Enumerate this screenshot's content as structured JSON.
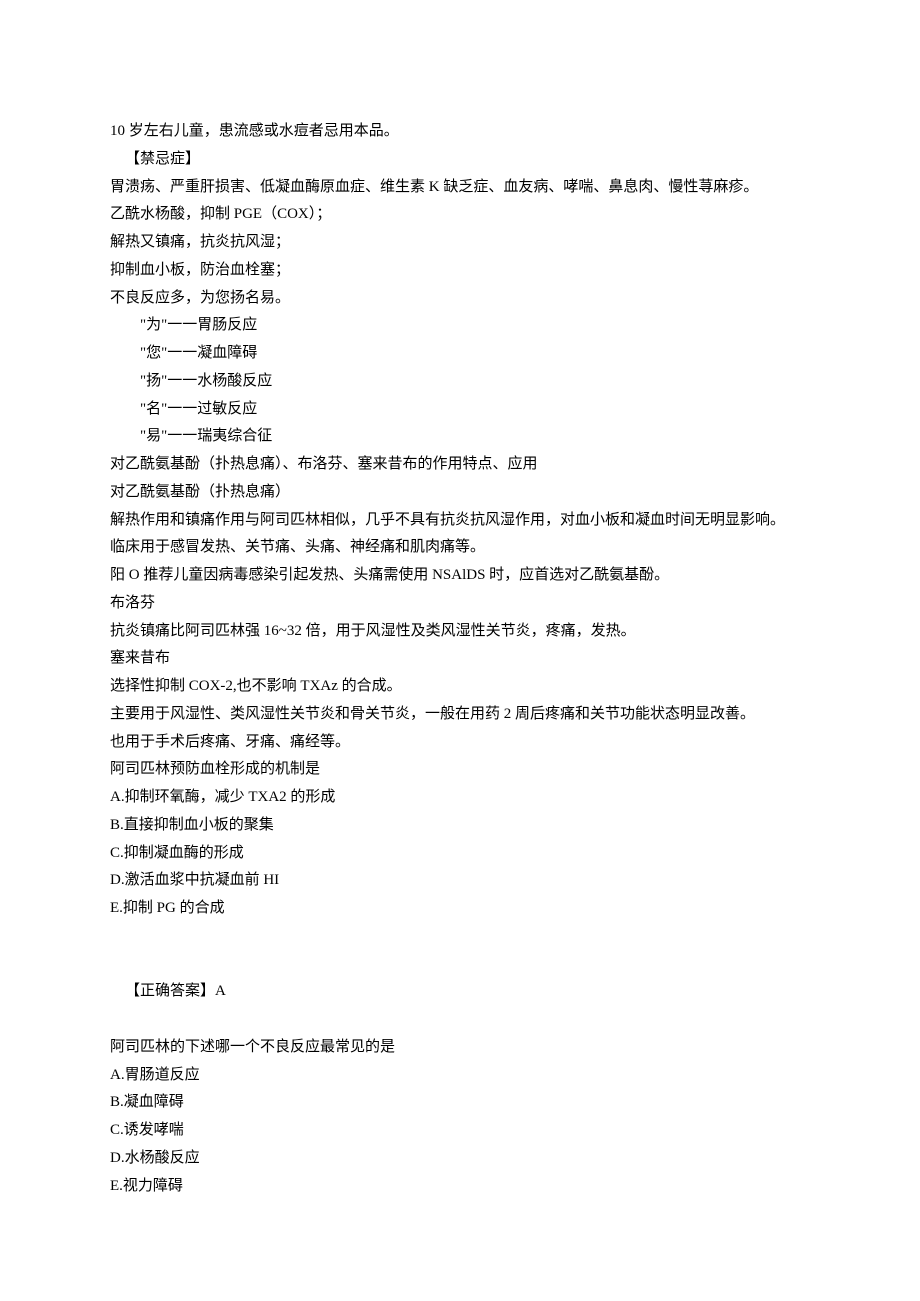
{
  "lines": [
    {
      "text": "10 岁左右儿童，患流感或水痘者忌用本品。",
      "indent": 0
    },
    {
      "text": "【禁忌症】",
      "indent": 1
    },
    {
      "text": "胃溃疡、严重肝损害、低凝血酶原血症、维生素 K 缺乏症、血友病、哮喘、鼻息肉、慢性荨麻疹。",
      "indent": 0
    },
    {
      "text": "乙酰水杨酸，抑制 PGE（COX）；",
      "indent": 0
    },
    {
      "text": "解热又镇痛，抗炎抗风湿；",
      "indent": 0
    },
    {
      "text": "抑制血小板，防治血栓塞；",
      "indent": 0
    },
    {
      "text": "不良反应多，为您扬名易。",
      "indent": 0
    },
    {
      "text": "\"为\"一一胃肠反应",
      "indent": 2
    },
    {
      "text": "\"您\"一一凝血障碍",
      "indent": 2
    },
    {
      "text": "\"扬\"一一水杨酸反应",
      "indent": 2
    },
    {
      "text": "\"名\"一一过敏反应",
      "indent": 2
    },
    {
      "text": "\"易\"一一瑞夷综合征",
      "indent": 2
    },
    {
      "text": "对乙酰氨基酚（扑热息痛）、布洛芬、塞来昔布的作用特点、应用",
      "indent": 0
    },
    {
      "text": "对乙酰氨基酚（扑热息痛）",
      "indent": 0
    },
    {
      "text": "解热作用和镇痛作用与阿司匹林相似，几乎不具有抗炎抗风湿作用，对血小板和凝血时间无明显影响。",
      "indent": 0
    },
    {
      "text": "临床用于感冒发热、关节痛、头痛、神经痛和肌肉痛等。",
      "indent": 0
    },
    {
      "text": "阳 O 推荐儿童因病毒感染引起发热、头痛需使用 NSAlDS 时，应首选对乙酰氨基酚。",
      "indent": 0
    },
    {
      "text": "布洛芬",
      "indent": 0
    },
    {
      "text": "抗炎镇痛比阿司匹林强 16~32 倍，用于风湿性及类风湿性关节炎，疼痛，发热。",
      "indent": 0
    },
    {
      "text": "塞来昔布",
      "indent": 0
    },
    {
      "text": "选择性抑制 COX-2,也不影响 TXAz 的合成。",
      "indent": 0
    },
    {
      "text": "主要用于风湿性、类风湿性关节炎和骨关节炎，一般在用药 2 周后疼痛和关节功能状态明显改善。",
      "indent": 0
    },
    {
      "text": "也用于手术后疼痛、牙痛、痛经等。",
      "indent": 0
    },
    {
      "text": "阿司匹林预防血栓形成的机制是",
      "indent": 0
    },
    {
      "text": "A.抑制环氧酶，减少 TXA2 的形成",
      "indent": 0
    },
    {
      "text": "B.直接抑制血小板的聚集",
      "indent": 0
    },
    {
      "text": "C.抑制凝血酶的形成",
      "indent": 0
    },
    {
      "text": "D.激活血浆中抗凝血前 HI",
      "indent": 0
    },
    {
      "text": "E.抑制 PG 的合成",
      "indent": 0
    },
    {
      "spacer": true
    },
    {
      "spacer": true
    },
    {
      "text": "【正确答案】A",
      "indent": 1
    },
    {
      "spacer": true
    },
    {
      "text": "阿司匹林的下述哪一个不良反应最常见的是",
      "indent": 0
    },
    {
      "text": "A.胃肠道反应",
      "indent": 0
    },
    {
      "text": "B.凝血障碍",
      "indent": 0
    },
    {
      "text": "C.诱发哮喘",
      "indent": 0
    },
    {
      "text": "D.水杨酸反应",
      "indent": 0
    },
    {
      "text": "E.视力障碍",
      "indent": 0
    }
  ]
}
